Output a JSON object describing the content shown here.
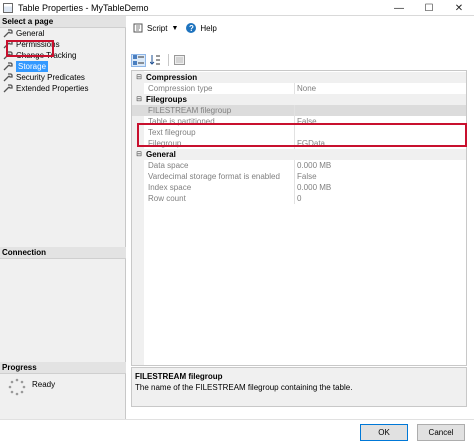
{
  "window": {
    "title": "Table Properties - MyTableDemo",
    "controls": {
      "minimize": "—",
      "maximize": "☐",
      "close": "✕"
    }
  },
  "left_pane": {
    "select_page_header": "Select a page",
    "pages": [
      {
        "label": "General",
        "selected": false
      },
      {
        "label": "Permissions",
        "selected": false
      },
      {
        "label": "Change Tracking",
        "selected": false
      },
      {
        "label": "Storage",
        "selected": true
      },
      {
        "label": "Security Predicates",
        "selected": false
      },
      {
        "label": "Extended Properties",
        "selected": false
      }
    ],
    "connection_header": "Connection",
    "progress_header": "Progress",
    "progress_status": "Ready"
  },
  "toolbar": {
    "script_label": "Script",
    "help_label": "Help"
  },
  "property_grid": {
    "rows": [
      {
        "type": "category",
        "name": "Compression",
        "value": ""
      },
      {
        "type": "property",
        "name": "Compression type",
        "value": "None"
      },
      {
        "type": "category",
        "name": "Filegroups",
        "value": ""
      },
      {
        "type": "property",
        "name": "FILESTREAM filegroup",
        "value": ""
      },
      {
        "type": "property",
        "name": "Table is partitioned",
        "value": "False"
      },
      {
        "type": "property",
        "name": "Text filegroup",
        "value": ""
      },
      {
        "type": "property",
        "name": "Filegroup",
        "value": "FGData"
      },
      {
        "type": "category",
        "name": "General",
        "value": ""
      },
      {
        "type": "property",
        "name": "Data space",
        "value": "0.000 MB"
      },
      {
        "type": "property",
        "name": "Vardecimal storage format is enabled",
        "value": "False"
      },
      {
        "type": "property",
        "name": "Index space",
        "value": "0.000 MB"
      },
      {
        "type": "property",
        "name": "Row count",
        "value": "0"
      }
    ],
    "description_title": "FILESTREAM filegroup",
    "description_text": "The name of the FILESTREAM filegroup containing the table."
  },
  "buttons": {
    "ok_label": "OK",
    "cancel_label": "Cancel"
  },
  "colors": {
    "selection_blue": "#3399ff",
    "highlight_red": "#c8102e",
    "help_blue": "#1e73be"
  }
}
